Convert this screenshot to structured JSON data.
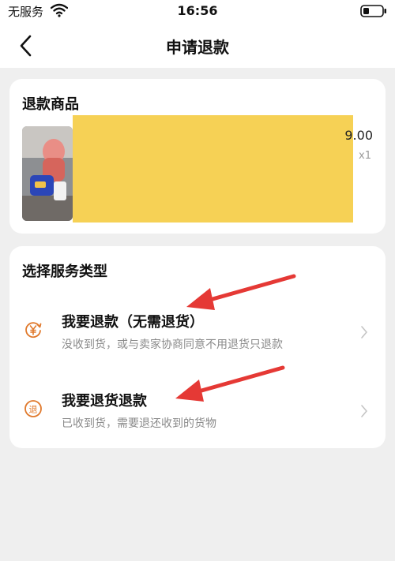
{
  "status_bar": {
    "carrier": "无服务",
    "time": "16:56",
    "wifi_icon": "wifi-icon",
    "battery_icon": "battery-icon"
  },
  "nav": {
    "title": "申请退款",
    "back_icon": "chevron-left-icon"
  },
  "product_card": {
    "title": "退款商品",
    "price": "9.00",
    "quantity": "x1"
  },
  "service_card": {
    "title": "选择服务类型",
    "options": [
      {
        "title": "我要退款（无需退货）",
        "desc": "没收到货，或与卖家协商同意不用退货只退款",
        "icon": "refund-yuan-icon"
      },
      {
        "title": "我要退货退款",
        "desc": "已收到货，需要退还收到的货物",
        "icon": "return-goods-icon"
      }
    ]
  },
  "colors": {
    "accent_orange": "#e0792c",
    "annotation_red": "#e53935",
    "redaction_yellow": "#f6d155"
  }
}
